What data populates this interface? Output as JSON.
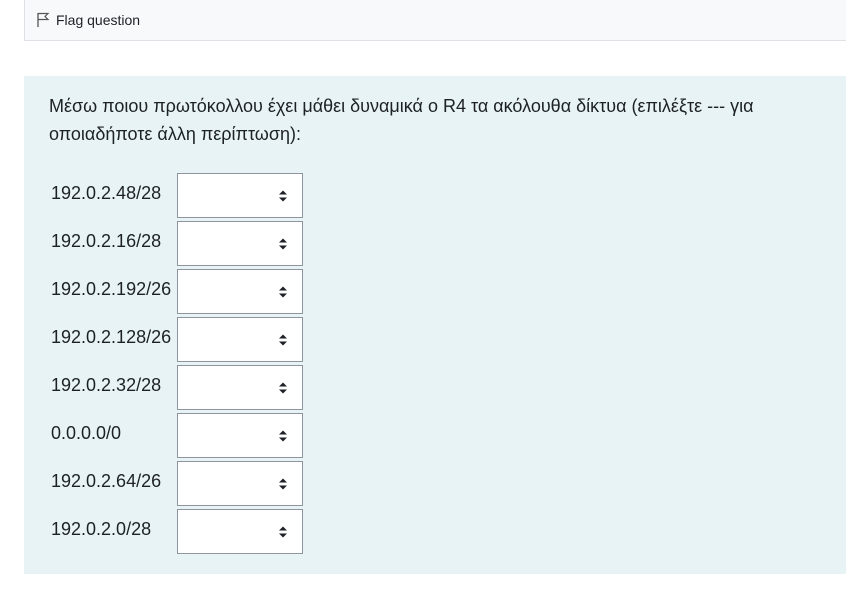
{
  "flag": {
    "label": "Flag question",
    "icon": "flag-icon"
  },
  "question": {
    "text": "Μέσω ποιου πρωτόκολλου έχει μάθει δυναμικά ο R4 τα ακόλουθα δίκτυα (επιλέξτε --- για οποιαδήποτε άλλη περίπτωση):",
    "rows": [
      {
        "label": "192.0.2.48/28",
        "value": ""
      },
      {
        "label": "192.0.2.16/28",
        "value": ""
      },
      {
        "label": "192.0.2.192/26",
        "value": ""
      },
      {
        "label": "192.0.2.128/26",
        "value": ""
      },
      {
        "label": "192.0.2.32/28",
        "value": ""
      },
      {
        "label": "0.0.0.0/0",
        "value": ""
      },
      {
        "label": "192.0.2.64/26",
        "value": ""
      },
      {
        "label": "192.0.2.0/28",
        "value": ""
      }
    ]
  },
  "colors": {
    "question_bg": "#e7f3f5",
    "flag_bar_bg": "#f8f9fa",
    "text": "#1d2125"
  }
}
